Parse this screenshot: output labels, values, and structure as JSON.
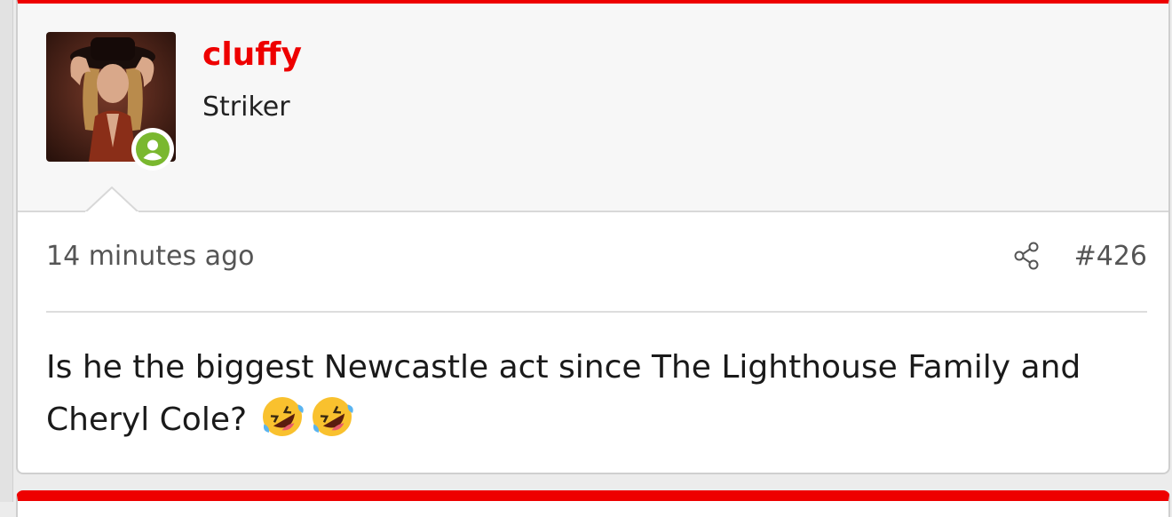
{
  "post": {
    "author": {
      "username": "cluffy",
      "title": "Striker",
      "avatar_icon": "user-avatar-photo",
      "status_icon": "online-user-icon",
      "status_color": "#7ab82f"
    },
    "meta": {
      "time": "14 minutes ago",
      "share_icon": "share-icon",
      "number": "#426"
    },
    "body": {
      "text": "Is he the biggest Newcastle act since The Lighthouse Family and Cheryl Cole?",
      "emojis": [
        "rolling-on-floor-laughing-emoji",
        "rolling-on-floor-laughing-emoji"
      ]
    }
  },
  "colors": {
    "accent": "#ee0000",
    "username": "#ee0000"
  }
}
